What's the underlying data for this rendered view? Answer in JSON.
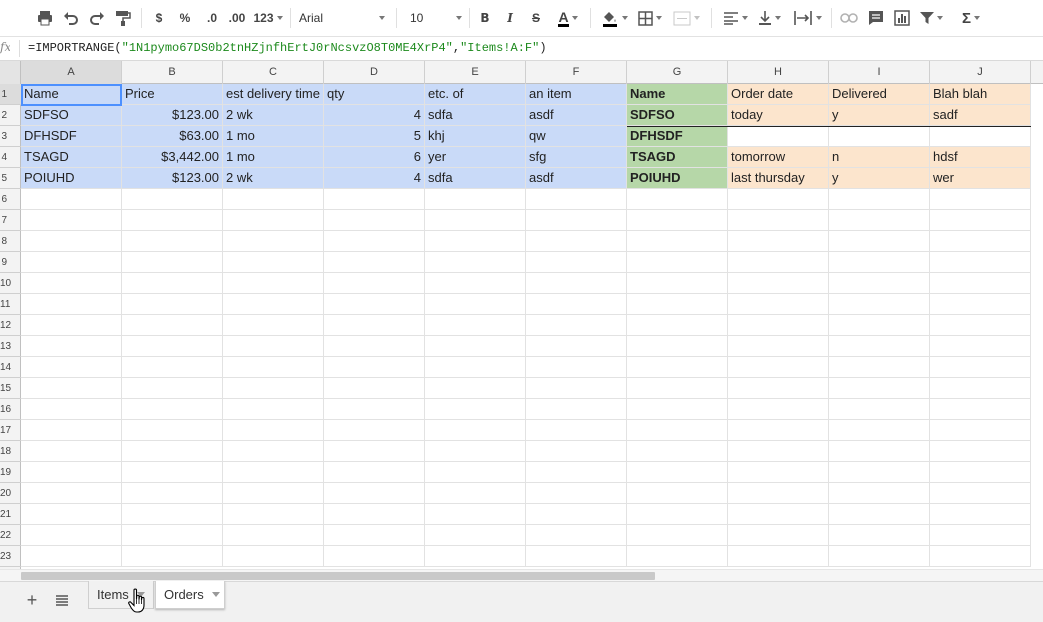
{
  "toolbar": {
    "currency_label": "$",
    "percent_label": "%",
    "decrease_decimal_label": ".0",
    "increase_decimal_label": ".00",
    "more_formats_label": "123",
    "font_family": "Arial",
    "font_size": "10",
    "bold_label": "B",
    "italic_label": "I",
    "strike_label": "S",
    "text_color_label": "A",
    "sum_label": "Σ"
  },
  "formula_bar": {
    "fx_label": "fx",
    "prefix": "=IMPORTRANGE(",
    "arg1": "\"1N1pymo67DS0b2tnHZjnfhErtJ0rNcsvzO8T0ME4XrP4\"",
    "comma": ",",
    "arg2": "\"Items!A:F\"",
    "suffix": ")"
  },
  "columns": [
    "A",
    "B",
    "C",
    "D",
    "E",
    "F",
    "G",
    "H",
    "I",
    "J"
  ],
  "row_numbers": [
    "1",
    "2",
    "3",
    "4",
    "5",
    "6",
    "7",
    "8",
    "9",
    "10",
    "11",
    "12",
    "13",
    "14",
    "15",
    "16",
    "17",
    "18",
    "19",
    "20",
    "21",
    "22",
    "23"
  ],
  "rows": [
    [
      "Name",
      "Price",
      "est delivery time",
      "qty",
      "etc. of",
      "an item",
      "Name",
      "Order date",
      "Delivered",
      "Blah blah"
    ],
    [
      "SDFSO",
      "$123.00",
      "2 wk",
      "4",
      "sdfa",
      "asdf",
      "SDFSO",
      "today",
      "y",
      "sadf"
    ],
    [
      "DFHSDF",
      "$63.00",
      "1 mo",
      "5",
      "khj",
      "qw",
      "DFHSDF",
      "",
      "",
      ""
    ],
    [
      "TSAGD",
      "$3,442.00",
      "1 mo",
      "6",
      "yer",
      "sfg",
      "TSAGD",
      "tomorrow",
      "n",
      "hdsf"
    ],
    [
      "POIUHD",
      "$123.00",
      "2 wk",
      "4",
      "sdfa",
      "asdf",
      "POIUHD",
      "last thursday",
      "y",
      "wer"
    ]
  ],
  "sheet_tabs": [
    {
      "label": "Items",
      "active": false
    },
    {
      "label": "Orders",
      "active": true
    }
  ],
  "colors": {
    "imported_range": "#c9daf8",
    "name_column": "#b6d7a8",
    "order_columns": "#fce5cd",
    "selection": "#4d90fe",
    "formula_string": "#1d8a1d"
  }
}
